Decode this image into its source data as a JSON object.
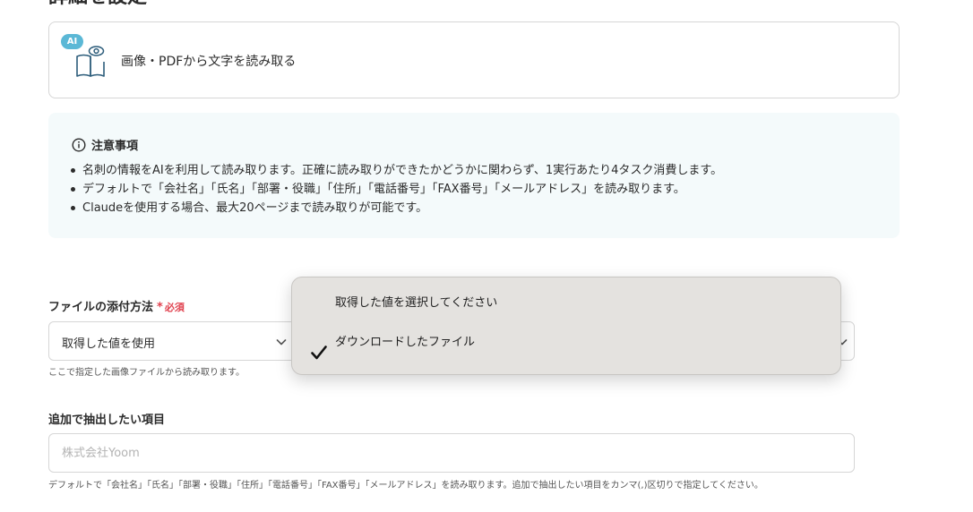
{
  "section": {
    "heading": "詳細を設定"
  },
  "action": {
    "badge": "AI",
    "label": "画像・PDFから文字を読み取る"
  },
  "notice": {
    "title": "注意事項",
    "items": [
      "名刺の情報をAIを利用して読み取ります。正確に読み取りができたかどうかに関わらず、1実行あたり4タスク消費します。",
      "デフォルトで「会社名」「氏名」「部署・役職」「住所」「電話番号」「FAX番号」「メールアドレス」を読み取ります。",
      "Claudeを使用する場合、最大20ページまで読み取りが可能です。"
    ]
  },
  "file_method": {
    "label": "ファイルの添付方法",
    "required_mark": "*",
    "required_text": "必須",
    "value": "取得した値を使用",
    "help": "ここで指定した画像ファイルから読み取ります。"
  },
  "dropdown": {
    "options": [
      {
        "label": "取得した値を選択してください",
        "selected": false
      },
      {
        "label": "ダウンロードしたファイル",
        "selected": true
      }
    ]
  },
  "extra_fields": {
    "label": "追加で抽出したい項目",
    "placeholder": "株式会社Yoom",
    "help": "デフォルトで「会社名」「氏名」「部署・役職」「住所」「電話番号」「FAX番号」「メールアドレス」を読み取ります。追加で抽出したい項目をカンマ(,)区切りで指定してください。"
  },
  "colors": {
    "accent": "#5bb8d6",
    "required": "#e0414e",
    "notice_bg": "#f4fafb",
    "dropdown_bg": "#e4e2df"
  }
}
